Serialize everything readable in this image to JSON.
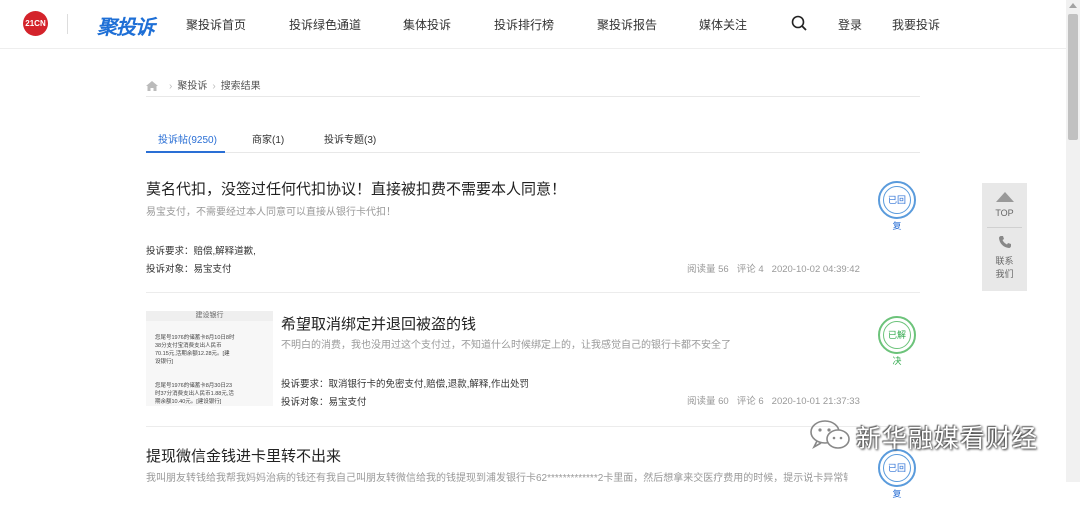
{
  "header": {
    "logo_21cn": "21CN",
    "logo_brand": "聚投诉",
    "nav": [
      "聚投诉首页",
      "投诉绿色通道",
      "集体投诉",
      "投诉排行榜",
      "聚投诉报告",
      "媒体关注"
    ],
    "login": "登录",
    "complain": "我要投诉"
  },
  "breadcrumb": {
    "site": "聚投诉",
    "current": "搜索结果"
  },
  "tabs": [
    {
      "label": "投诉帖(9250)",
      "active": true
    },
    {
      "label": "商家(1)",
      "active": false
    },
    {
      "label": "投诉专题(3)",
      "active": false
    }
  ],
  "items": [
    {
      "title": "莫名代扣，没签过任何代扣协议！直接被扣费不需要本人同意！",
      "desc": "易宝支付，不需要经过本人同意可以直接从银行卡代扣！",
      "demand": "投诉要求：赔偿,解释道歉,",
      "target": "投诉对象：易宝支付",
      "reads": "阅读量 56",
      "comments": "评论 4",
      "time": "2020-10-02 04:39:42",
      "status": "已回复"
    },
    {
      "title": "希望取消绑定并退回被盗的钱",
      "desc": "不明白的消费，我也没用过这个支付过，不知道什么时候绑定上的，让我感觉自己的银行卡都不安全了",
      "demand": "投诉要求：取消银行卡的免密支付,赔偿,退款,解释,作出处罚",
      "target": "投诉对象：易宝支付",
      "reads": "阅读量 60",
      "comments": "评论 6",
      "time": "2020-10-01 21:37:33",
      "status": "已解决",
      "thumb": {
        "header": "建设银行",
        "block1": "您尾号1976的储蓄卡8月10日8时38分支付宝消费支出人民币70.15元,活期余额12.28元。[建设银行]",
        "block2": "您尾号1976的储蓄卡8月30日23时37分消费支出人民币1.88元,活期余额10.40元。[建设银行]"
      }
    },
    {
      "title": "提现微信金钱进卡里转不出来",
      "desc": "我叫朋友转钱给我帮我妈妈治病的钱还有我自己叫朋友转微信给我的钱提现到浦发银行卡62*************2卡里面，然后想拿来交医疗费用的时候，提示说卡异常转不出去",
      "status": "已回复"
    }
  ],
  "side": {
    "top": "TOP",
    "contact_line1": "联系",
    "contact_line2": "我们"
  },
  "watermark": "新华融媒看财经",
  "colors": {
    "accent": "#2a6fd5",
    "brand_red": "#d4232b",
    "resolved_green": "#2ea84a"
  }
}
